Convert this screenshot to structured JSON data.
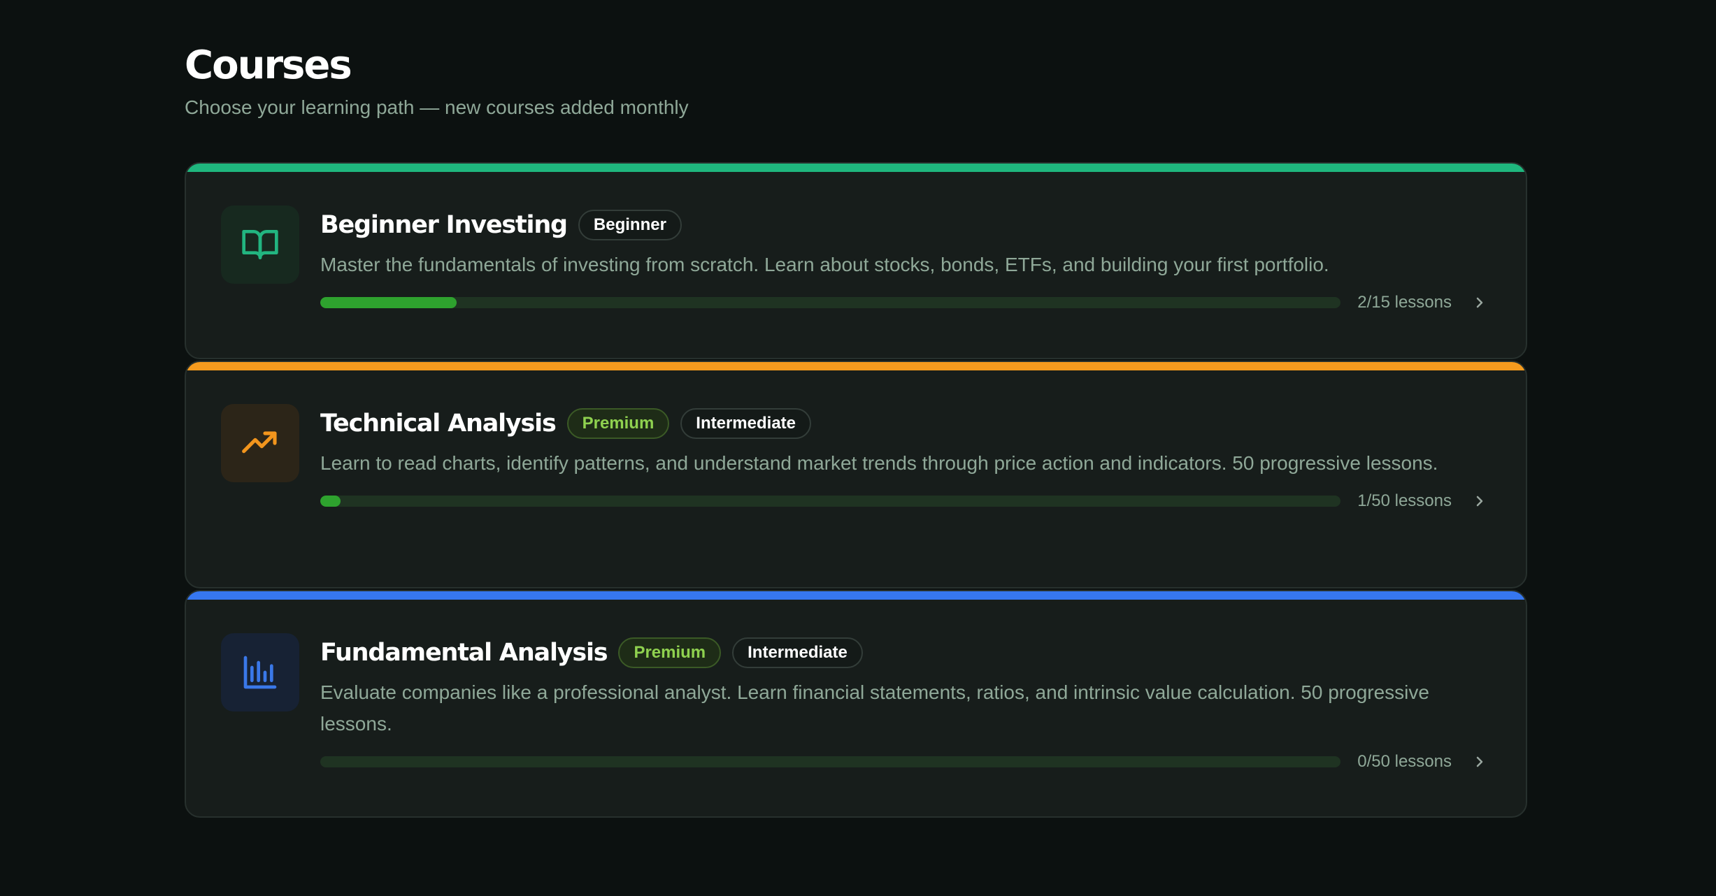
{
  "header": {
    "title": "Courses",
    "subtitle": "Choose your learning path — new courses added monthly"
  },
  "courses": [
    {
      "title": "Beginner Investing",
      "badges": [
        "Beginner"
      ],
      "premium": false,
      "description": "Master the fundamentals of investing from scratch. Learn about stocks, bonds, ETFs, and building your first portfolio.",
      "progress_label": "2/15 lessons",
      "progress_fraction": 0.1333,
      "accent_color": "#1fb77e",
      "icon": "book-icon",
      "icon_color": "#22b580",
      "icon_bg": "#17291f"
    },
    {
      "title": "Technical Analysis",
      "badges": [
        "Premium",
        "Intermediate"
      ],
      "premium": true,
      "description": "Learn to read charts, identify patterns, and understand market trends through price action and indicators. 50 progressive lessons.",
      "progress_label": "1/50 lessons",
      "progress_fraction": 0.02,
      "accent_color": "#f59b1e",
      "icon": "trending-up-icon",
      "icon_color": "#f2951d",
      "icon_bg": "#2c2518"
    },
    {
      "title": "Fundamental Analysis",
      "badges": [
        "Premium",
        "Intermediate"
      ],
      "premium": true,
      "description": "Evaluate companies like a professional analyst. Learn financial statements, ratios, and intrinsic value calculation. 50 progressive lessons.",
      "progress_label": "0/50 lessons",
      "progress_fraction": 0,
      "accent_color": "#3677f0",
      "icon": "bar-chart-icon",
      "icon_color": "#3a78e8",
      "icon_bg": "#172234"
    }
  ],
  "colors": {
    "background": "#0c1110",
    "card": "#171d1b",
    "progress_fill": "#2ea22e",
    "progress_track": "#1f3322",
    "muted_text": "#8fa898"
  }
}
